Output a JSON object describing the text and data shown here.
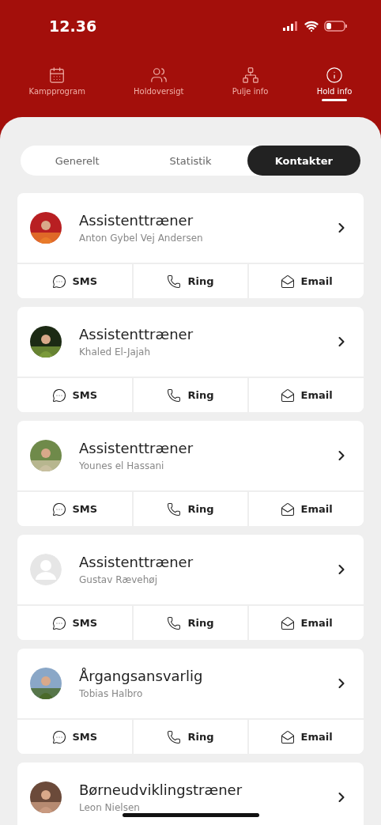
{
  "status_bar": {
    "time": "12.36"
  },
  "nav_tabs": [
    {
      "label": "Kampprogram",
      "selected": false
    },
    {
      "label": "Holdoversigt",
      "selected": false
    },
    {
      "label": "Pulje info",
      "selected": false
    },
    {
      "label": "Hold info",
      "selected": true
    }
  ],
  "segments": [
    {
      "label": "Generelt",
      "selected": false
    },
    {
      "label": "Statistik",
      "selected": false
    },
    {
      "label": "Kontakter",
      "selected": true
    }
  ],
  "contacts": [
    {
      "kind": "picture",
      "role": "Assistenttræner",
      "name": "Anton Gybel Vej Andersen",
      "actions": [
        {
          "kind": "sms",
          "label": "SMS"
        },
        {
          "kind": "call",
          "label": "Ring"
        },
        {
          "kind": "email",
          "label": "Email"
        }
      ]
    },
    {
      "kind": "picture",
      "role": "Assistenttræner",
      "name": "Khaled El-Jajah",
      "actions": [
        {
          "kind": "sms",
          "label": "SMS"
        },
        {
          "kind": "call",
          "label": "Ring"
        },
        {
          "kind": "email",
          "label": "Email"
        }
      ]
    },
    {
      "kind": "picture",
      "role": "Assistenttræner",
      "name": "Younes el Hassani",
      "actions": [
        {
          "kind": "sms",
          "label": "SMS"
        },
        {
          "kind": "call",
          "label": "Ring"
        },
        {
          "kind": "email",
          "label": "Email"
        }
      ]
    },
    {
      "kind": "placeholder",
      "role": "Assistenttræner",
      "name": "Gustav Rævehøj",
      "actions": [
        {
          "kind": "sms",
          "label": "SMS"
        },
        {
          "kind": "call",
          "label": "Ring"
        },
        {
          "kind": "email",
          "label": "Email"
        }
      ]
    },
    {
      "kind": "picture",
      "role": "Årgangsansvarlig",
      "name": "Tobias Halbro",
      "actions": [
        {
          "kind": "sms",
          "label": "SMS"
        },
        {
          "kind": "call",
          "label": "Ring"
        },
        {
          "kind": "email",
          "label": "Email"
        }
      ]
    },
    {
      "kind": "picture",
      "role": "Børneudviklingstræner",
      "name": "Leon Nielsen"
    }
  ]
}
